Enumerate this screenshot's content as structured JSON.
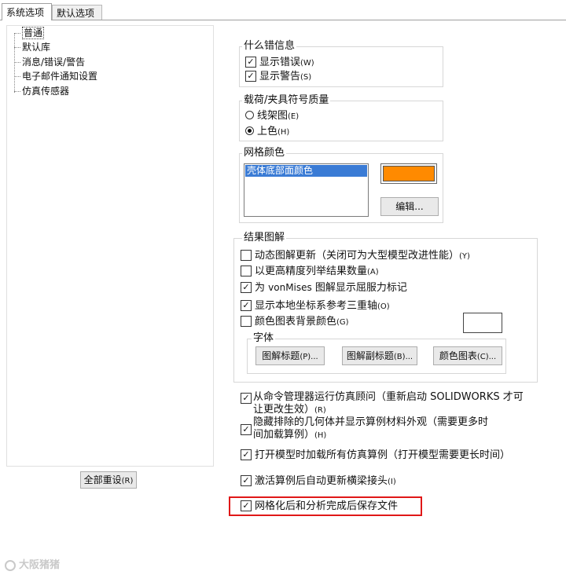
{
  "tabs": [
    "系统选项",
    "默认选项"
  ],
  "tree": {
    "items": [
      "普通",
      "默认库",
      "消息/错误/警告",
      "电子邮件通知设置",
      "仿真传感器"
    ]
  },
  "reset_button": "全部重设",
  "reset_shortcut": "(R)",
  "errors_group": {
    "title": "什么错信息",
    "show_errors": {
      "label": "显示错误",
      "shortcut": "(W)",
      "checked": true
    },
    "show_warnings": {
      "label": "显示警告",
      "shortcut": "(S)",
      "checked": true
    }
  },
  "load_group": {
    "title": "载荷/夹具符号质量",
    "wireframe": {
      "label": "线架图",
      "shortcut": "(E)",
      "selected": false
    },
    "shaded": {
      "label": "上色",
      "shortcut": "(H)",
      "selected": true
    }
  },
  "mesh_color_group": {
    "title": "网格颜色",
    "list_selected": "壳体底部面颜色",
    "swatch_color": "#ff8a00",
    "edit_button": "编辑..."
  },
  "results_group": {
    "title": "结果图解",
    "dynamic_update": {
      "label": "动态图解更新（关闭可为大型模型改进性能）",
      "shortcut": "(Y)",
      "checked": false
    },
    "higher_precision": {
      "label": "以更高精度列举结果数量",
      "shortcut": "(A)",
      "checked": false
    },
    "vonmises_prefix": "为 ",
    "vonmises_key": "vonMises",
    "vonmises_suffix": " 图解显示屈服力标记",
    "vonmises_checked": true,
    "local_triad": {
      "label": "显示本地坐标系参考三重轴",
      "shortcut": "(O)",
      "checked": true
    },
    "chart_bg": {
      "label": "颜色图表背景颜色",
      "shortcut": "(G)",
      "checked": false
    },
    "chart_bg_color": "#ffffff",
    "font_group": {
      "title": "字体",
      "plot_title": "图解标题",
      "plot_title_shortcut": "(P)...",
      "plot_subtitle": "图解副标题",
      "plot_subtitle_shortcut": "(B)...",
      "color_chart": "颜色图表",
      "color_chart_shortcut": "(C)..."
    }
  },
  "bottom_options": {
    "run_advisor": {
      "line1": "从命令管理器运行仿真顾问（重新启动 SOLIDWORKS 才可",
      "line2": "让更改生效）",
      "shortcut": "(R)",
      "checked": true
    },
    "hide_excluded": {
      "line1": "隐藏排除的几何体并显示算例材料外观（需要更多时",
      "line2": "间加载算例）",
      "shortcut": "(H)",
      "checked": true
    },
    "load_all_studies": {
      "label": "打开模型时加载所有仿真算例（打开模型需要更长时间）",
      "checked": true
    },
    "auto_update_beams": {
      "label": "激活算例后自动更新横梁接头",
      "shortcut": "(I)",
      "checked": true
    },
    "save_after_mesh": {
      "label": "网格化后和分析完成后保存文件",
      "checked": true
    }
  },
  "highlight_color": "#e01818",
  "watermark": "大阪猪猪"
}
